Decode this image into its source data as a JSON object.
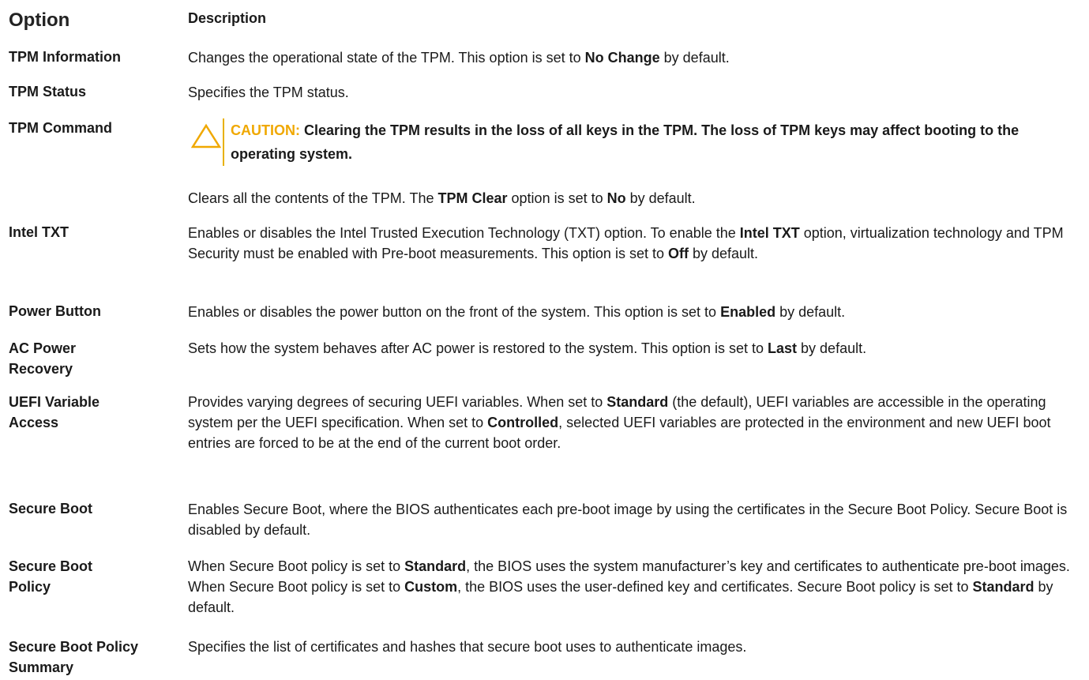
{
  "header": {
    "option": "Option",
    "description": "Description"
  },
  "rows": [
    {
      "option": "TPM Information",
      "parts": [
        "Changes the operational state of the TPM. This option is set to ",
        "No Change",
        " by default."
      ]
    },
    {
      "option": "TPM Status",
      "parts": [
        "Specifies the TPM status."
      ]
    },
    {
      "option": "TPM Command",
      "caution_label": "CAUTION:",
      "caution_text": " Clearing the TPM results in the loss of all keys in the TPM. The loss of TPM keys may affect booting to the operating system.",
      "parts": [
        "Clears all the contents of the TPM. The ",
        "TPM Clear",
        " option is set to ",
        "No",
        " by default."
      ]
    },
    {
      "option": "Intel TXT",
      "parts": [
        "Enables or disables the Intel Trusted Execution Technology (TXT) option. To enable the ",
        "Intel TXT",
        " option, virtualization technology and TPM Security must be enabled with Pre-boot measurements. This option is set to ",
        "Off",
        " by default."
      ]
    },
    {
      "option": "Power Button",
      "parts": [
        "Enables or disables the power button on the front of the system. This option is set to ",
        "Enabled",
        " by default."
      ]
    },
    {
      "option": "AC Power Recovery",
      "parts": [
        "Sets how the system behaves after AC power is restored to the system. This option is set to ",
        "Last",
        " by default."
      ]
    },
    {
      "option": "UEFI Variable Access",
      "parts": [
        "Provides varying degrees of securing UEFI variables. When set to ",
        "Standard",
        " (the default), UEFI variables are accessible in the operating system per the UEFI specification. When set to ",
        "Controlled",
        ", selected UEFI variables are protected in the environment and new UEFI boot entries are forced to be at the end of the current boot order."
      ]
    },
    {
      "option": "Secure Boot",
      "parts": [
        "Enables Secure Boot, where the BIOS authenticates each pre-boot image by using the certificates in the Secure Boot Policy. Secure Boot is disabled by default."
      ]
    },
    {
      "option": "Secure Boot Policy",
      "parts": [
        "When Secure Boot policy is set to ",
        "Standard",
        ", the BIOS uses the system manufacturer’s key and certificates to authenticate pre-boot images. When Secure Boot policy is set to ",
        "Custom",
        ", the BIOS uses the user-defined key and certificates. Secure Boot policy is set to ",
        "Standard",
        " by default."
      ]
    },
    {
      "option": "Secure Boot Policy Summary",
      "parts": [
        "Specifies the list of certificates and hashes that secure boot uses to authenticate images."
      ]
    }
  ],
  "colors": {
    "caution_accent": "#f0a800",
    "text": "#1a1a1a"
  },
  "icons": {
    "caution": "warning-triangle-icon"
  }
}
